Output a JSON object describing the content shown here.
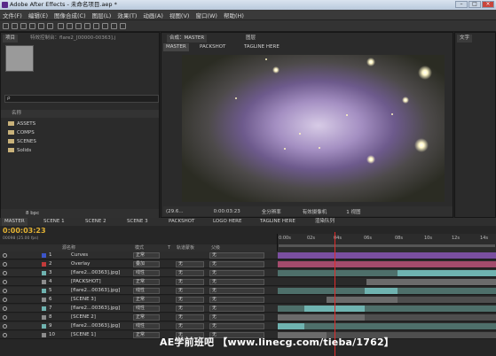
{
  "window": {
    "title": "Adobe After Effects - 未命名项目.aep *",
    "buttons": [
      "–",
      "□",
      "×"
    ]
  },
  "menu": [
    "文件(F)",
    "编辑(E)",
    "图像合成(C)",
    "图层(L)",
    "效果(T)",
    "动画(A)",
    "视图(V)",
    "窗口(W)",
    "帮助(H)"
  ],
  "project_panel": {
    "tabs": [
      "项目",
      "特效控制台：flare2_[00000-00363].j"
    ],
    "search_placeholder": "ρ",
    "column_name": "名称",
    "items": [
      "ASSETS",
      "COMPS",
      "SCENES",
      "Solids"
    ],
    "bpc": "8 bpc"
  },
  "viewer": {
    "tabs": [
      "合成：MASTER",
      "图层"
    ],
    "nav": [
      "MASTER",
      "PACKSHOT",
      "TAGLINE HERE"
    ],
    "zoom": "(29.6...",
    "timecode": "0:00:03:23",
    "quality": "全分辨率",
    "camera": "有效摄像机",
    "views": "1 视图"
  },
  "right_panel": {
    "label": "文字"
  },
  "timeline": {
    "tabs": [
      "MASTER",
      "SCENE 1",
      "SCENE 2",
      "SCENE 3",
      "PACKSHOT",
      "LOGO HERE",
      "TAGLINE HERE",
      "渲染队列"
    ],
    "timecode": "0:00:03:23",
    "fps": "00098 (25.00 fps)",
    "col_source": "源名称",
    "col_mode": "模式",
    "col_t": "T",
    "col_trkmat": "轨道蒙板",
    "col_parent": "父级",
    "ruler": [
      "0:00s",
      "02s",
      "04s",
      "06s",
      "08s",
      "10s",
      "12s",
      "14s"
    ],
    "layers": [
      {
        "num": "1",
        "name": "Curves",
        "mode": "正常",
        "trk": "",
        "parent": "无",
        "color": "#3c55c9"
      },
      {
        "num": "2",
        "name": "Overlay",
        "mode": "叠加",
        "trk": "无",
        "parent": "无",
        "color": "#c23a3a"
      },
      {
        "num": "3",
        "name": "[flare2...00363].jpg]",
        "mode": "线性",
        "trk": "无",
        "parent": "无",
        "color": "#6fb3b0"
      },
      {
        "num": "4",
        "name": "[PACKSHOT]",
        "mode": "正常",
        "trk": "无",
        "parent": "无",
        "color": "#8c8c8c"
      },
      {
        "num": "5",
        "name": "[flare2...00363].jpg]",
        "mode": "线性",
        "trk": "无",
        "parent": "无",
        "color": "#6fb3b0"
      },
      {
        "num": "6",
        "name": "[SCENE 3]",
        "mode": "正常",
        "trk": "无",
        "parent": "无",
        "color": "#8c8c8c"
      },
      {
        "num": "7",
        "name": "[flare2...00363].jpg]",
        "mode": "线性",
        "trk": "无",
        "parent": "无",
        "color": "#6fb3b0"
      },
      {
        "num": "8",
        "name": "[SCENE 2]",
        "mode": "正常",
        "trk": "无",
        "parent": "无",
        "color": "#8c8c8c"
      },
      {
        "num": "9",
        "name": "[flare2...00363].jpg]",
        "mode": "线性",
        "trk": "无",
        "parent": "无",
        "color": "#6fb3b0"
      },
      {
        "num": "10",
        "name": "[SCENE 1]",
        "mode": "正常",
        "trk": "无",
        "parent": "无",
        "color": "#8c8c8c"
      }
    ]
  },
  "watermark": "AE学前班吧 【www.linecg.com/tieba/1762】"
}
